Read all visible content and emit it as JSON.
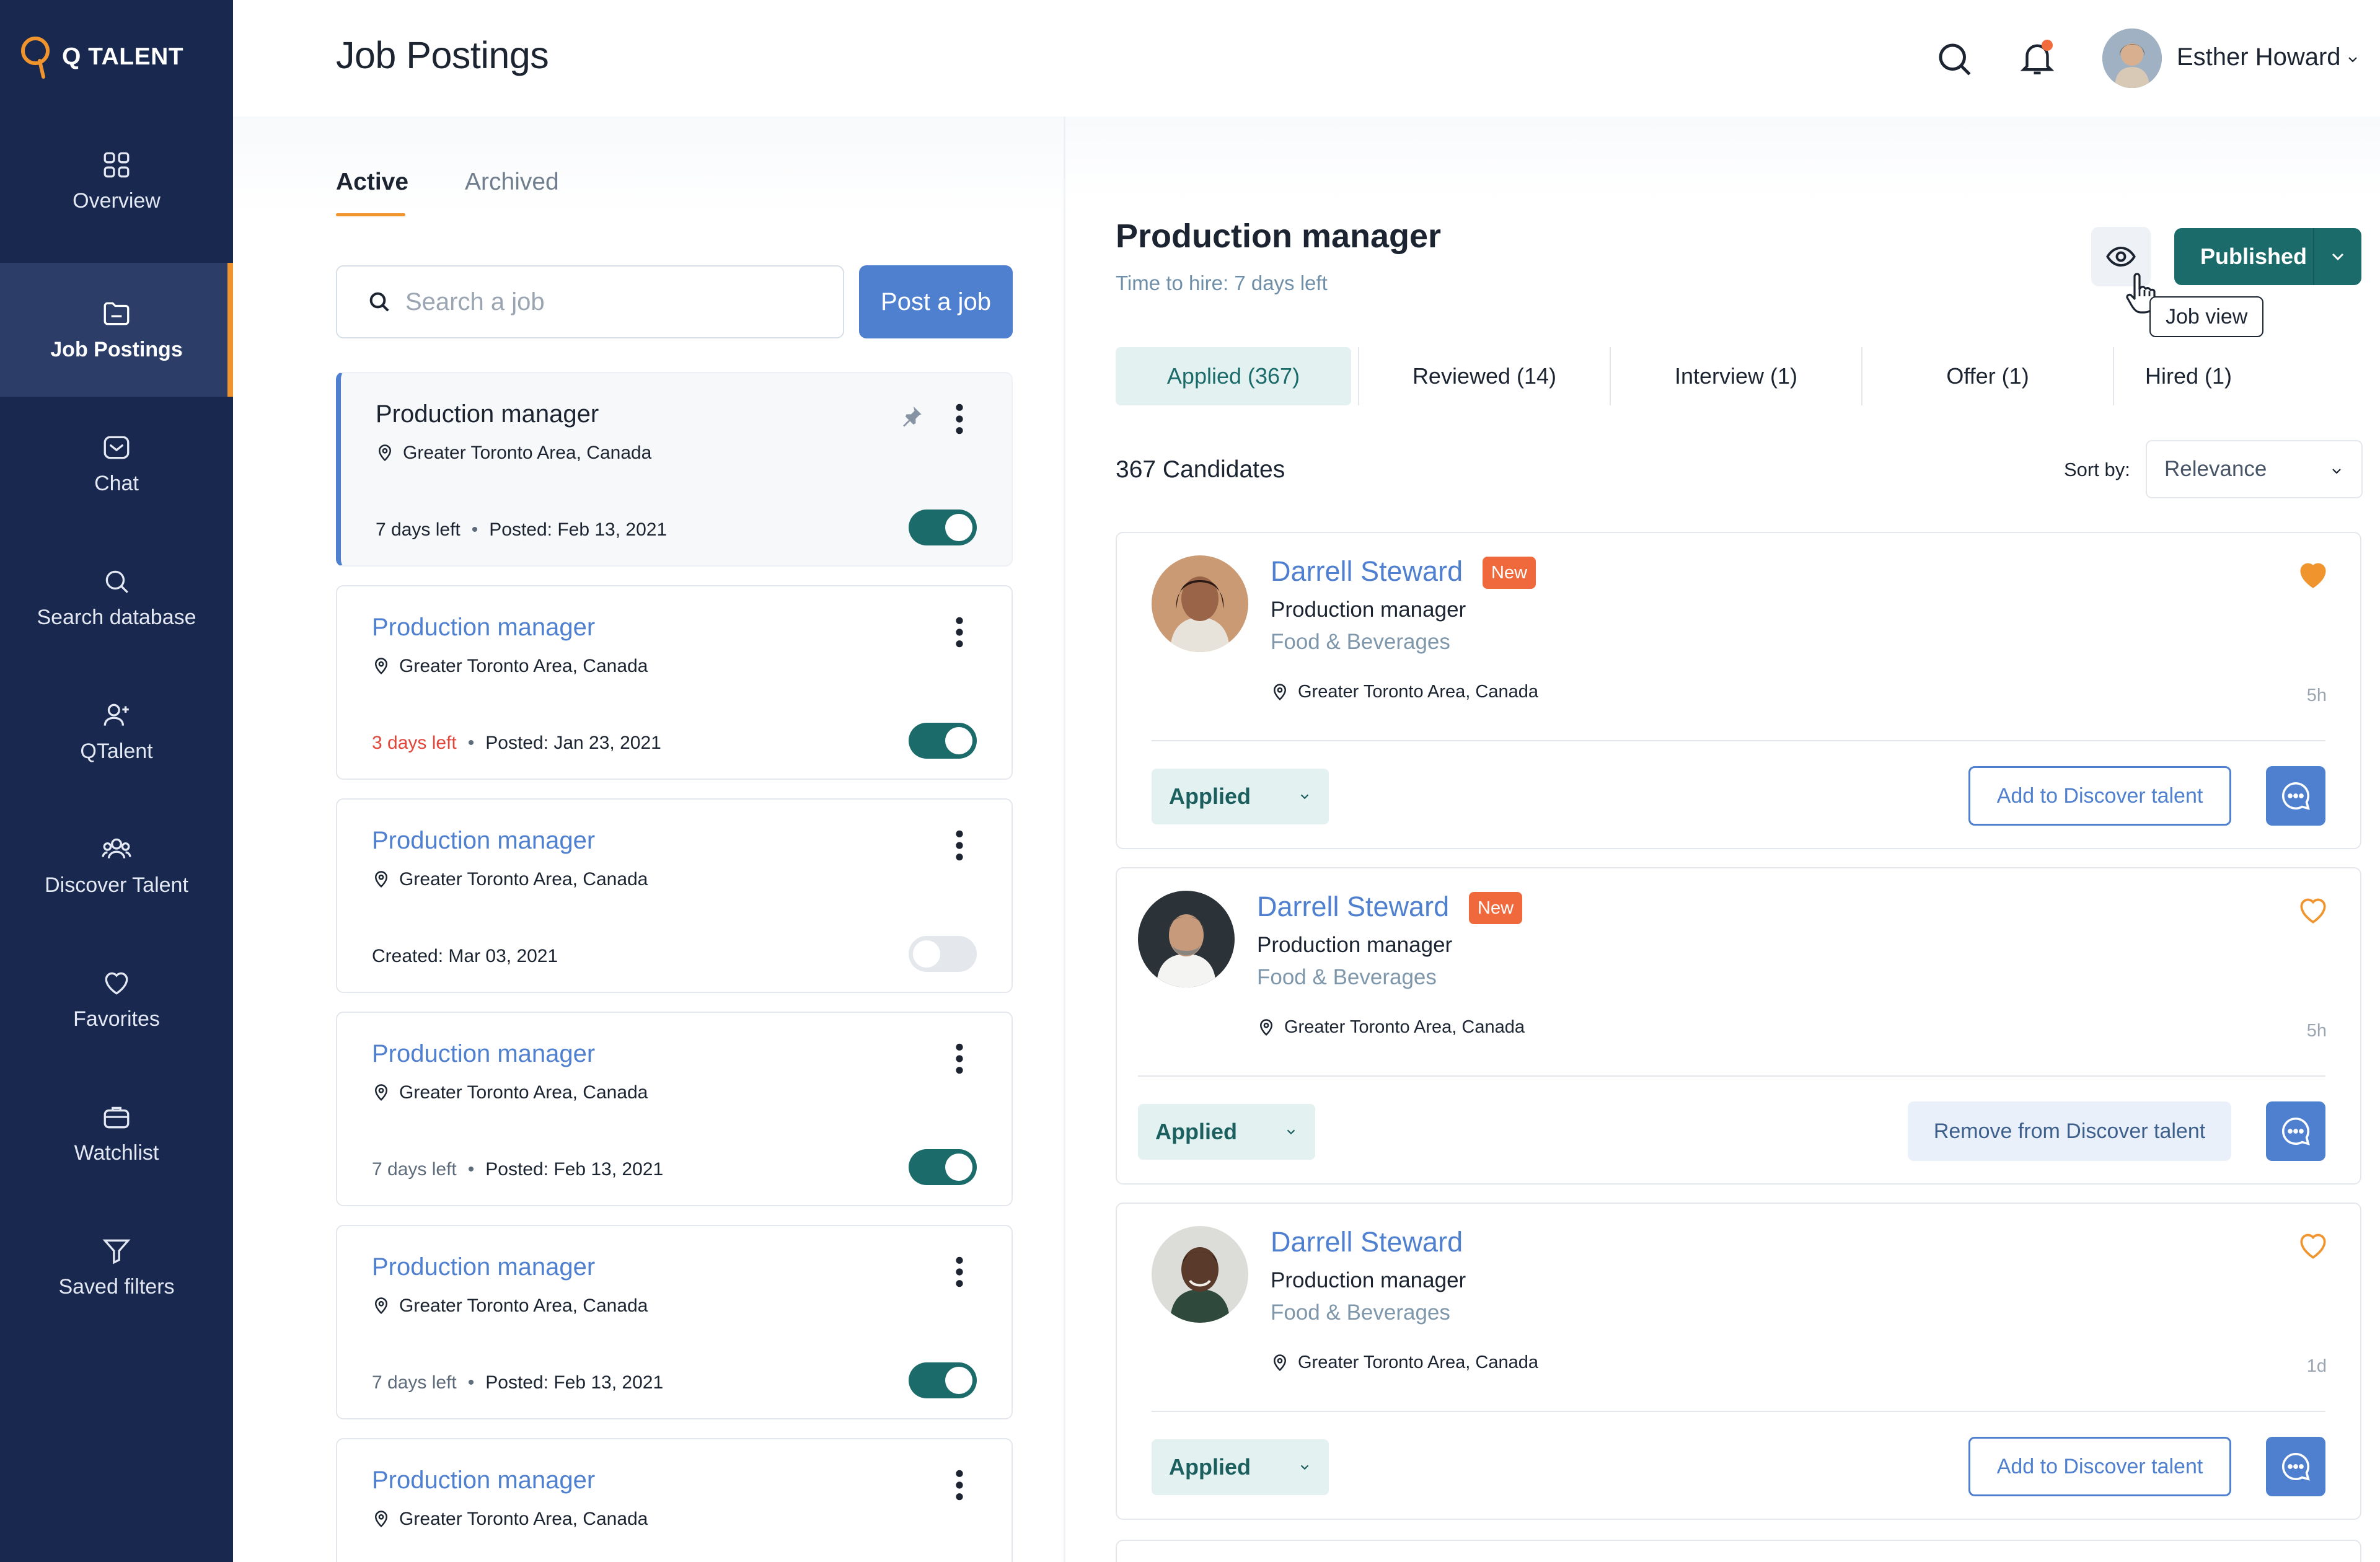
{
  "brand": {
    "name": "Q TALENT",
    "accent": "#f0942e",
    "sidebar_bg": "#18284f",
    "primary": "#4f7fcf",
    "teal": "#1b6b6b"
  },
  "sidebar": {
    "items": [
      {
        "label": "Overview",
        "icon": "grid-icon"
      },
      {
        "label": "Job Postings",
        "icon": "folder-icon",
        "active": true
      },
      {
        "label": "Chat",
        "icon": "chat-icon"
      },
      {
        "label": "Search database",
        "icon": "search-icon"
      },
      {
        "label": "QTalent",
        "icon": "user-add-icon"
      },
      {
        "label": "Discover Talent",
        "icon": "users-icon"
      },
      {
        "label": "Favorites",
        "icon": "heart-icon"
      },
      {
        "label": "Watchlist",
        "icon": "briefcase-icon"
      },
      {
        "label": "Saved filters",
        "icon": "filter-icon"
      }
    ]
  },
  "header": {
    "title": "Job Postings",
    "user_name": "Esther Howard",
    "has_notification": true
  },
  "jobs_panel": {
    "tabs": [
      "Active",
      "Archived"
    ],
    "active_tab": "Active",
    "search_placeholder": "Search a job",
    "post_button": "Post a job",
    "jobs": [
      {
        "title": "Production manager",
        "location": "Greater Toronto Area, Canada",
        "left": "7 days left",
        "posted": "Posted: Feb 13, 2021",
        "published": true,
        "pinned": true,
        "selected": true,
        "urgent": false
      },
      {
        "title": "Production manager",
        "location": "Greater Toronto Area, Canada",
        "left": "3 days left",
        "posted": "Posted: Jan 23, 2021",
        "published": true,
        "urgent": true
      },
      {
        "title": "Production manager",
        "location": "Greater Toronto Area, Canada",
        "left": "",
        "posted": "Created: Mar 03, 2021",
        "published": false
      },
      {
        "title": "Production manager",
        "location": "Greater Toronto Area, Canada",
        "left": "7 days left",
        "posted": "Posted: Feb 13, 2021",
        "published": true
      },
      {
        "title": "Production manager",
        "location": "Greater Toronto Area, Canada",
        "left": "7 days left",
        "posted": "Posted: Feb 13, 2021",
        "published": true
      },
      {
        "title": "Production manager",
        "location": "Greater Toronto Area, Canada"
      }
    ]
  },
  "detail": {
    "title": "Production manager",
    "time_to_hire": "Time to hire: 7 days left",
    "view_tooltip": "Job view",
    "status": "Published",
    "stages": [
      "Applied (367)",
      "Reviewed (14)",
      "Interview (1)",
      "Offer (1)",
      "Hired (1)"
    ],
    "active_stage": "Applied (367)",
    "candidate_count": "367 Candidates",
    "sort_label": "Sort by:",
    "sort_value": "Relevance",
    "candidates": [
      {
        "name": "Darrell Steward",
        "badge": "New",
        "role": "Production manager",
        "industry": "Food & Beverages",
        "location": "Greater Toronto Area, Canada",
        "time": "5h",
        "status": "Applied",
        "action": "Add to Discover talent",
        "favorited": true
      },
      {
        "name": "Darrell Steward",
        "badge": "New",
        "role": "Production manager",
        "industry": "Food & Beverages",
        "location": "Greater Toronto Area, Canada",
        "time": "5h",
        "status": "Applied",
        "action": "Remove from Discover talent",
        "favorited": false
      },
      {
        "name": "Darrell Steward",
        "badge": "",
        "role": "Production manager",
        "industry": "Food & Beverages",
        "location": "Greater Toronto Area, Canada",
        "time": "1d",
        "status": "Applied",
        "action": "Add to Discover talent",
        "favorited": false
      }
    ]
  }
}
